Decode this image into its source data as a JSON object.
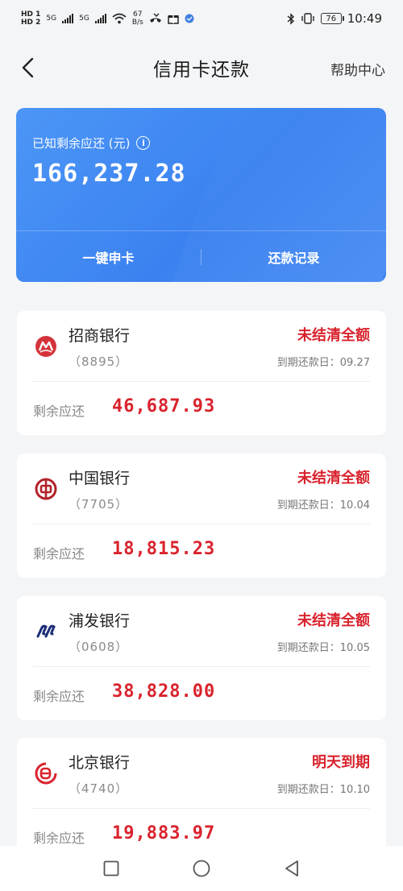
{
  "status_bar": {
    "hd1": "HD 1",
    "hd2": "HD 2",
    "net1": "5G",
    "net2": "5G",
    "speed_value": "67",
    "speed_unit": "B/s",
    "battery": "76",
    "time": "10:49"
  },
  "header": {
    "title": "信用卡还款",
    "help_label": "帮助中心"
  },
  "summary": {
    "label": "已知剩余应还 (元)",
    "amount": "166,237.28",
    "action_apply": "一键申卡",
    "action_records": "还款记录"
  },
  "remain_label": "剩余应还",
  "due_prefix": "到期还款日：",
  "cards": [
    {
      "bank": "招商银行",
      "tail": "（8895）",
      "status": "未结清全额",
      "due": "到期还款日：09.27",
      "remain": "46,687.93"
    },
    {
      "bank": "中国银行",
      "tail": "（7705）",
      "status": "未结清全额",
      "due": "到期还款日：10.04",
      "remain": "18,815.23"
    },
    {
      "bank": "浦发银行",
      "tail": "（0608）",
      "status": "未结清全额",
      "due": "到期还款日：10.05",
      "remain": "38,828.00"
    },
    {
      "bank": "北京银行",
      "tail": "（4740）",
      "status": "明天到期",
      "due": "到期还款日：10.10",
      "remain": "19,883.97"
    }
  ],
  "colors": {
    "accent_blue": "#3b82f0",
    "alert_red": "#d9232d",
    "cmb_red": "#d4333b",
    "boc_red": "#b3222a",
    "spdb_navy": "#1e2f7a",
    "bob_red": "#d9232d"
  }
}
